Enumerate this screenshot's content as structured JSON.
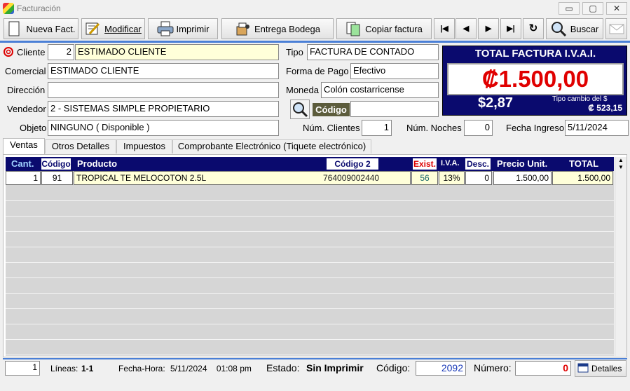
{
  "window": {
    "title": "Facturación",
    "min": "▭",
    "max": "▢",
    "close": "✕"
  },
  "toolbar": {
    "nueva": "Nueva Fact.",
    "modificar": "Modificar",
    "imprimir": "Imprimir",
    "entrega": "Entrega Bodega",
    "copiar": "Copiar factura",
    "first": "|◀",
    "prev": "◀",
    "next": "▶",
    "last": "▶|",
    "refresh": "↻",
    "buscar": "Buscar"
  },
  "form": {
    "cliente_label": "Cliente",
    "cliente_id": "2",
    "cliente_nombre": "ESTIMADO CLIENTE",
    "comercial_label": "Comercial",
    "comercial": "ESTIMADO CLIENTE",
    "direccion_label": "Dirección",
    "direccion": "",
    "vendedor_label": "Vendedor",
    "vendedor": "2 - SISTEMAS SIMPLE PROPIETARIO",
    "objeto_label": "Objeto",
    "objeto": "NINGUNO    ( Disponible )",
    "tipo_label": "Tipo",
    "tipo": "FACTURA DE CONTADO",
    "forma_pago_label": "Forma de Pago",
    "forma_pago": "Efectivo",
    "moneda_label": "Moneda",
    "moneda": "Colón costarricense",
    "codigo_label": "Código",
    "codigo": "",
    "num_clientes_label": "Núm. Clientes",
    "num_clientes": "1",
    "num_noches_label": "Núm. Noches",
    "num_noches": "0",
    "fecha_ingreso_label": "Fecha Ingreso",
    "fecha_ingreso": "5/11/2024"
  },
  "total": {
    "title": "TOTAL FACTURA I.V.A.I.",
    "amount": "₡1.500,00",
    "usd": "$2,87",
    "tc_label": "Tipo cambio del $",
    "tc_value": "₡ 523,15"
  },
  "tabs": [
    {
      "label": "Ventas"
    },
    {
      "label": "Otros Detalles"
    },
    {
      "label": "Impuestos"
    },
    {
      "label": "Comprobante Electrónico (Tiquete electrónico)"
    }
  ],
  "grid": {
    "columns": {
      "cant": "Cant.",
      "codigo": "Código",
      "producto": "Producto",
      "codigo2": "Código 2",
      "exist": "Exist.",
      "iva": "I.V.A.",
      "desc": "Desc.",
      "precio": "Precio Unit.",
      "total": "TOTAL"
    },
    "rows": [
      {
        "cant": "1",
        "codigo": "91",
        "producto": "TROPICAL TE MELOCOTON 2.5L",
        "codigo2": "764009002440",
        "exist": "56",
        "iva": "13%",
        "desc": "0",
        "precio": "1.500,00",
        "total": "1.500,00"
      }
    ]
  },
  "status": {
    "counter": "1",
    "lineas_label": "Líneas:",
    "lineas": "1-1",
    "fecha_hora_label": "Fecha-Hora:",
    "fecha_hora": "5/11/2024    01:08 pm",
    "estado_label": "Estado:",
    "estado": "Sin Imprimir",
    "codigo_label": "Código:",
    "codigo": "2092",
    "numero_label": "Número:",
    "numero": "0",
    "detalles": "Detalles"
  },
  "colors": {
    "accent": "#0a0a6e",
    "total_red": "#e00000",
    "field_yellow": "#ffffd9"
  }
}
